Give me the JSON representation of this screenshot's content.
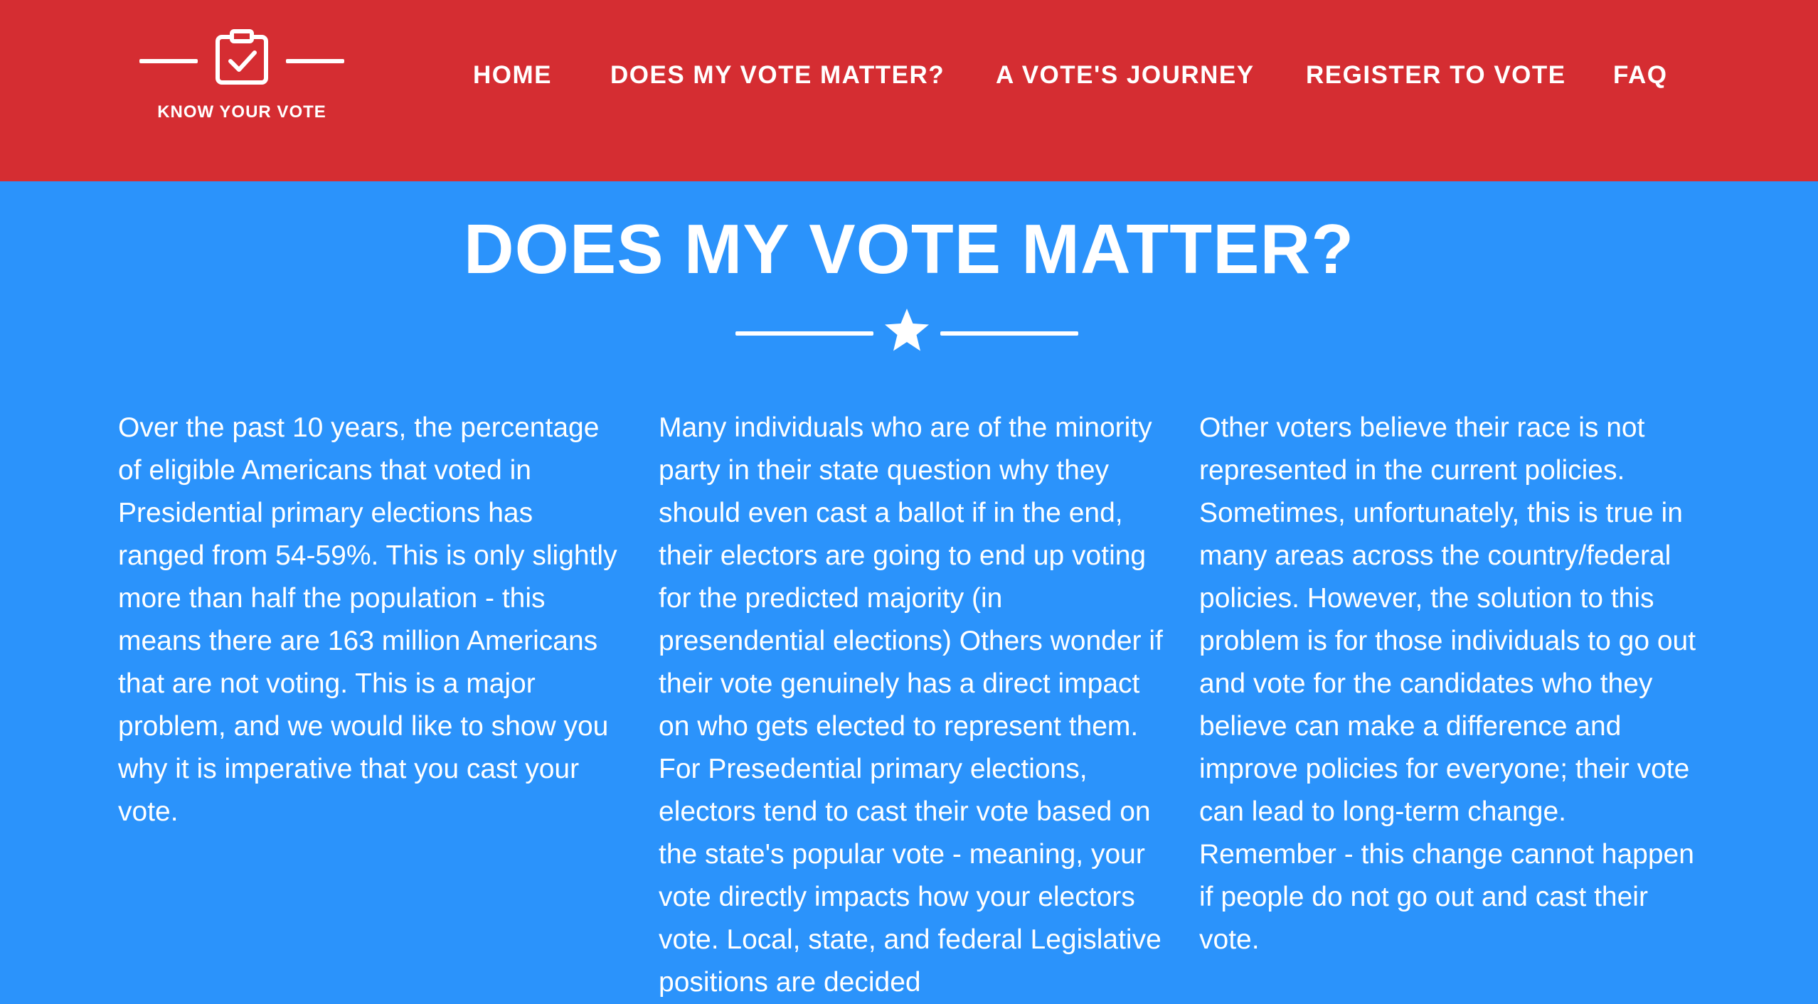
{
  "brand": {
    "name": "KNOW YOUR VOTE",
    "logo_icon": "clipboard-check-icon"
  },
  "nav": {
    "items": [
      {
        "label": "HOME"
      },
      {
        "label": "DOES MY VOTE MATTER?"
      },
      {
        "label": "A VOTE'S JOURNEY"
      },
      {
        "label": "REGISTER TO VOTE"
      },
      {
        "label": "FAQ"
      }
    ]
  },
  "main": {
    "title": "DOES MY VOTE MATTER?",
    "divider_icon": "star-icon",
    "columns": [
      {
        "text": "Over the past 10 years, the percentage of eligible Americans that voted in Presidential primary elections has ranged from 54-59%. This is only slightly more than half the population - this means there are 163 million Americans that are not voting. This is a major problem, and we would like to show you why it is imperative that you cast your vote."
      },
      {
        "text": "Many individuals who are of the minority party in their state question why they should even cast a ballot if in the end, their electors are going to end up voting for the predicted majority (in presendential elections) Others wonder if their vote genuinely has a direct impact on who gets elected to represent them. For Presedential primary elections, electors tend to cast their vote based on the state's popular vote - meaning, your vote directly impacts how your electors vote. Local, state, and federal Legislative positions are decided"
      },
      {
        "text": "Other voters believe their race is not represented in the current policies. Sometimes, unfortunately, this is true in many areas across the country/federal policies. However, the solution to this problem is for those individuals to go out and vote for the candidates who they believe can make a difference and improve policies for everyone; their vote can lead to long-term change. Remember - this change cannot happen if people do not go out and cast their vote."
      }
    ]
  },
  "colors": {
    "header_bg": "#d52d32",
    "page_bg": "#2b93fb",
    "text": "#ffffff"
  }
}
